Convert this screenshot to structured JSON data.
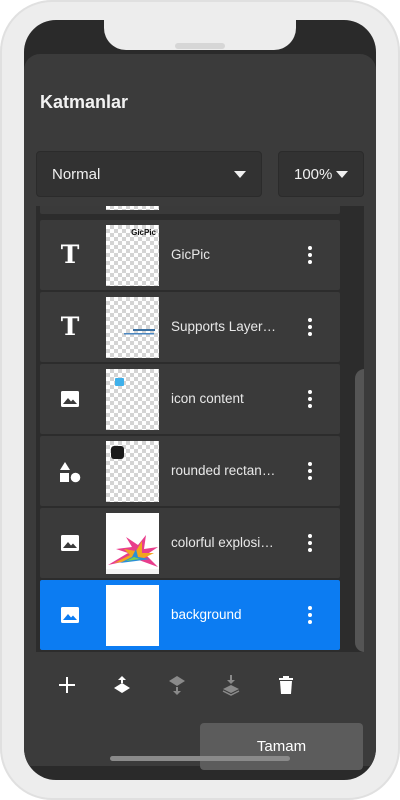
{
  "panel": {
    "title": "Katmanlar"
  },
  "blend_mode": {
    "selected": "Normal"
  },
  "opacity": {
    "selected": "100%"
  },
  "layers": [
    {
      "type_icon": "text-icon",
      "type_glyph": "T",
      "label": "GicPic",
      "thumb_text": "GicPic",
      "selected": false
    },
    {
      "type_icon": "text-icon",
      "type_glyph": "T",
      "label": "Supports Layer…",
      "selected": false
    },
    {
      "type_icon": "image-icon",
      "label": "icon content",
      "selected": false
    },
    {
      "type_icon": "shapes-icon",
      "label": "rounded rectan…",
      "selected": false
    },
    {
      "type_icon": "image-icon",
      "label": "colorful explosi…",
      "selected": false
    },
    {
      "type_icon": "image-icon",
      "label": "background",
      "selected": true
    }
  ],
  "toolbar": {
    "add_icon": "plus-icon",
    "move_up_icon": "move-up-icon",
    "move_down_icon": "move-down-icon",
    "merge_down_icon": "merge-down-icon",
    "delete_icon": "trash-icon"
  },
  "done_button": {
    "label": "Tamam"
  },
  "colors": {
    "selected_row": "#0c7cf2",
    "panel": "#3b3b3b",
    "row": "#3a3a3a"
  }
}
